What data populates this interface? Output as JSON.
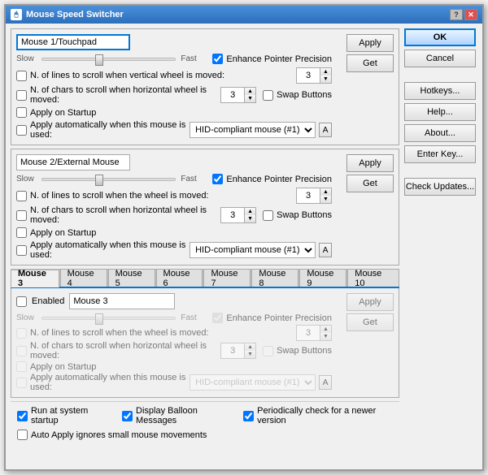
{
  "window": {
    "title": "Mouse Speed Switcher",
    "icon": "🖱"
  },
  "titlebar": {
    "help_label": "?",
    "close_label": "✕"
  },
  "mouse1": {
    "name": "Mouse 1/Touchpad",
    "enhance_label": "Enhance Pointer Precision",
    "enhance_checked": true,
    "slow_label": "Slow",
    "fast_label": "Fast",
    "scroll_v_label": "N. of lines to scroll when vertical wheel is moved:",
    "scroll_v_val": "3",
    "scroll_h_label": "N. of chars to scroll when  horizontal wheel is moved:",
    "scroll_h_val": "3",
    "swap_label": "Swap Buttons",
    "startup_label": "Apply on Startup",
    "auto_label": "Apply automatically when this mouse is used:",
    "auto_select": "HID-compliant mouse (#1)",
    "auto_a": "A",
    "apply_label": "Apply",
    "get_label": "Get"
  },
  "mouse2": {
    "name": "Mouse 2/External Mouse",
    "enhance_label": "Enhance Pointer Precision",
    "enhance_checked": true,
    "slow_label": "Slow",
    "fast_label": "Fast",
    "scroll_v_label": "N. of lines to scroll when the wheel is moved:",
    "scroll_v_val": "3",
    "scroll_h_label": "N. of chars to scroll when  horizontal wheel is moved:",
    "scroll_h_val": "3",
    "swap_label": "Swap Buttons",
    "startup_label": "Apply on Startup",
    "auto_label": "Apply automatically when this mouse is used:",
    "auto_select": "HID-compliant mouse (#1)",
    "auto_a": "A",
    "apply_label": "Apply",
    "get_label": "Get"
  },
  "tabs": {
    "items": [
      "Mouse 3",
      "Mouse 4",
      "Mouse 5",
      "Mouse 6",
      "Mouse 7",
      "Mouse 8",
      "Mouse 9",
      "Mouse 10"
    ],
    "active_index": 0
  },
  "mouse3": {
    "enabled_label": "Enabled",
    "name": "Mouse 3",
    "enhance_label": "Enhance Pointer Precision",
    "enhance_checked": true,
    "slow_label": "Slow",
    "fast_label": "Fast",
    "scroll_v_label": "N. of lines to scroll when the wheel is moved:",
    "scroll_v_val": "3",
    "scroll_h_label": "N. of chars to scroll when  horizontal wheel is moved:",
    "scroll_h_val": "3",
    "swap_label": "Swap Buttons",
    "startup_label": "Apply on Startup",
    "auto_label": "Apply automatically when this mouse is used:",
    "auto_select": "HID-compliant mouse (#1)",
    "auto_a": "A",
    "apply_label": "Apply",
    "get_label": "Get"
  },
  "side": {
    "ok_label": "OK",
    "cancel_label": "Cancel",
    "hotkeys_label": "Hotkeys...",
    "help_label": "Help...",
    "about_label": "About...",
    "enterkey_label": "Enter Key...",
    "checkupdates_label": "Check Updates..."
  },
  "bottom": {
    "run_startup_label": "Run at system startup",
    "balloon_label": "Display Balloon Messages",
    "periodic_label": "Periodically check for a newer version",
    "autoapply_label": "Auto Apply ignores small mouse movements"
  }
}
